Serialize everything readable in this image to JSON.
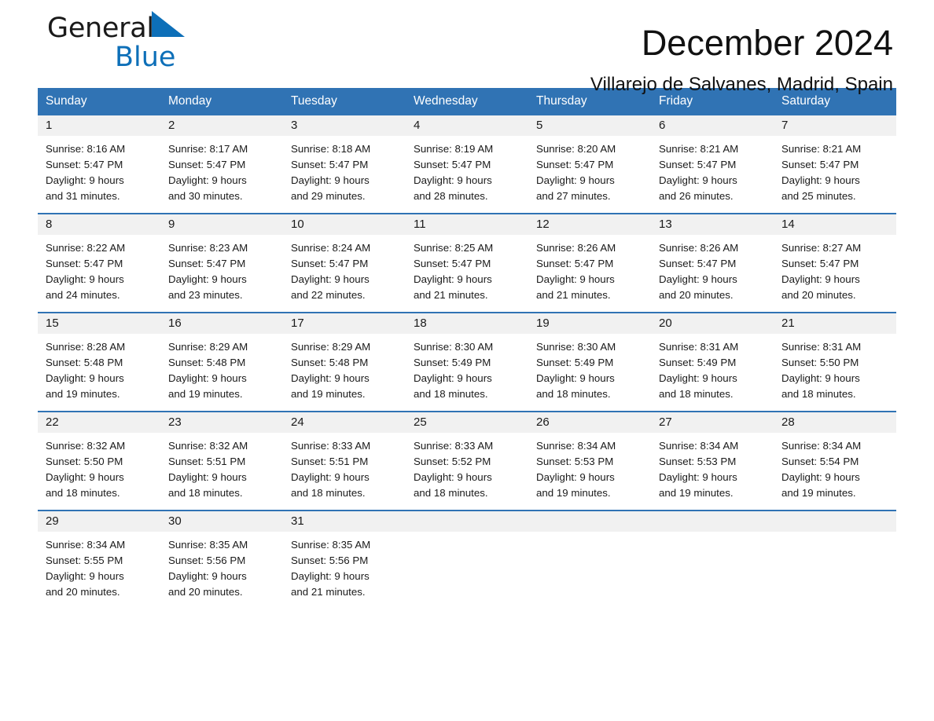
{
  "brand": {
    "logo_text_primary": "General",
    "logo_text_secondary": "Blue",
    "logo_icon": "blue-triangle-icon",
    "accent_color": "#0d6fb8"
  },
  "header": {
    "title": "December 2024",
    "location": "Villarejo de Salvanes, Madrid, Spain"
  },
  "calendar": {
    "header_background": "#3073b4",
    "daynum_background": "#f1f1f1",
    "weekday_headers": [
      "Sunday",
      "Monday",
      "Tuesday",
      "Wednesday",
      "Thursday",
      "Friday",
      "Saturday"
    ],
    "weeks": [
      [
        {
          "day": "1",
          "sunrise": "Sunrise: 8:16 AM",
          "sunset": "Sunset: 5:47 PM",
          "daylight_line1": "Daylight: 9 hours",
          "daylight_line2": "and 31 minutes."
        },
        {
          "day": "2",
          "sunrise": "Sunrise: 8:17 AM",
          "sunset": "Sunset: 5:47 PM",
          "daylight_line1": "Daylight: 9 hours",
          "daylight_line2": "and 30 minutes."
        },
        {
          "day": "3",
          "sunrise": "Sunrise: 8:18 AM",
          "sunset": "Sunset: 5:47 PM",
          "daylight_line1": "Daylight: 9 hours",
          "daylight_line2": "and 29 minutes."
        },
        {
          "day": "4",
          "sunrise": "Sunrise: 8:19 AM",
          "sunset": "Sunset: 5:47 PM",
          "daylight_line1": "Daylight: 9 hours",
          "daylight_line2": "and 28 minutes."
        },
        {
          "day": "5",
          "sunrise": "Sunrise: 8:20 AM",
          "sunset": "Sunset: 5:47 PM",
          "daylight_line1": "Daylight: 9 hours",
          "daylight_line2": "and 27 minutes."
        },
        {
          "day": "6",
          "sunrise": "Sunrise: 8:21 AM",
          "sunset": "Sunset: 5:47 PM",
          "daylight_line1": "Daylight: 9 hours",
          "daylight_line2": "and 26 minutes."
        },
        {
          "day": "7",
          "sunrise": "Sunrise: 8:21 AM",
          "sunset": "Sunset: 5:47 PM",
          "daylight_line1": "Daylight: 9 hours",
          "daylight_line2": "and 25 minutes."
        }
      ],
      [
        {
          "day": "8",
          "sunrise": "Sunrise: 8:22 AM",
          "sunset": "Sunset: 5:47 PM",
          "daylight_line1": "Daylight: 9 hours",
          "daylight_line2": "and 24 minutes."
        },
        {
          "day": "9",
          "sunrise": "Sunrise: 8:23 AM",
          "sunset": "Sunset: 5:47 PM",
          "daylight_line1": "Daylight: 9 hours",
          "daylight_line2": "and 23 minutes."
        },
        {
          "day": "10",
          "sunrise": "Sunrise: 8:24 AM",
          "sunset": "Sunset: 5:47 PM",
          "daylight_line1": "Daylight: 9 hours",
          "daylight_line2": "and 22 minutes."
        },
        {
          "day": "11",
          "sunrise": "Sunrise: 8:25 AM",
          "sunset": "Sunset: 5:47 PM",
          "daylight_line1": "Daylight: 9 hours",
          "daylight_line2": "and 21 minutes."
        },
        {
          "day": "12",
          "sunrise": "Sunrise: 8:26 AM",
          "sunset": "Sunset: 5:47 PM",
          "daylight_line1": "Daylight: 9 hours",
          "daylight_line2": "and 21 minutes."
        },
        {
          "day": "13",
          "sunrise": "Sunrise: 8:26 AM",
          "sunset": "Sunset: 5:47 PM",
          "daylight_line1": "Daylight: 9 hours",
          "daylight_line2": "and 20 minutes."
        },
        {
          "day": "14",
          "sunrise": "Sunrise: 8:27 AM",
          "sunset": "Sunset: 5:47 PM",
          "daylight_line1": "Daylight: 9 hours",
          "daylight_line2": "and 20 minutes."
        }
      ],
      [
        {
          "day": "15",
          "sunrise": "Sunrise: 8:28 AM",
          "sunset": "Sunset: 5:48 PM",
          "daylight_line1": "Daylight: 9 hours",
          "daylight_line2": "and 19 minutes."
        },
        {
          "day": "16",
          "sunrise": "Sunrise: 8:29 AM",
          "sunset": "Sunset: 5:48 PM",
          "daylight_line1": "Daylight: 9 hours",
          "daylight_line2": "and 19 minutes."
        },
        {
          "day": "17",
          "sunrise": "Sunrise: 8:29 AM",
          "sunset": "Sunset: 5:48 PM",
          "daylight_line1": "Daylight: 9 hours",
          "daylight_line2": "and 19 minutes."
        },
        {
          "day": "18",
          "sunrise": "Sunrise: 8:30 AM",
          "sunset": "Sunset: 5:49 PM",
          "daylight_line1": "Daylight: 9 hours",
          "daylight_line2": "and 18 minutes."
        },
        {
          "day": "19",
          "sunrise": "Sunrise: 8:30 AM",
          "sunset": "Sunset: 5:49 PM",
          "daylight_line1": "Daylight: 9 hours",
          "daylight_line2": "and 18 minutes."
        },
        {
          "day": "20",
          "sunrise": "Sunrise: 8:31 AM",
          "sunset": "Sunset: 5:49 PM",
          "daylight_line1": "Daylight: 9 hours",
          "daylight_line2": "and 18 minutes."
        },
        {
          "day": "21",
          "sunrise": "Sunrise: 8:31 AM",
          "sunset": "Sunset: 5:50 PM",
          "daylight_line1": "Daylight: 9 hours",
          "daylight_line2": "and 18 minutes."
        }
      ],
      [
        {
          "day": "22",
          "sunrise": "Sunrise: 8:32 AM",
          "sunset": "Sunset: 5:50 PM",
          "daylight_line1": "Daylight: 9 hours",
          "daylight_line2": "and 18 minutes."
        },
        {
          "day": "23",
          "sunrise": "Sunrise: 8:32 AM",
          "sunset": "Sunset: 5:51 PM",
          "daylight_line1": "Daylight: 9 hours",
          "daylight_line2": "and 18 minutes."
        },
        {
          "day": "24",
          "sunrise": "Sunrise: 8:33 AM",
          "sunset": "Sunset: 5:51 PM",
          "daylight_line1": "Daylight: 9 hours",
          "daylight_line2": "and 18 minutes."
        },
        {
          "day": "25",
          "sunrise": "Sunrise: 8:33 AM",
          "sunset": "Sunset: 5:52 PM",
          "daylight_line1": "Daylight: 9 hours",
          "daylight_line2": "and 18 minutes."
        },
        {
          "day": "26",
          "sunrise": "Sunrise: 8:34 AM",
          "sunset": "Sunset: 5:53 PM",
          "daylight_line1": "Daylight: 9 hours",
          "daylight_line2": "and 19 minutes."
        },
        {
          "day": "27",
          "sunrise": "Sunrise: 8:34 AM",
          "sunset": "Sunset: 5:53 PM",
          "daylight_line1": "Daylight: 9 hours",
          "daylight_line2": "and 19 minutes."
        },
        {
          "day": "28",
          "sunrise": "Sunrise: 8:34 AM",
          "sunset": "Sunset: 5:54 PM",
          "daylight_line1": "Daylight: 9 hours",
          "daylight_line2": "and 19 minutes."
        }
      ],
      [
        {
          "day": "29",
          "sunrise": "Sunrise: 8:34 AM",
          "sunset": "Sunset: 5:55 PM",
          "daylight_line1": "Daylight: 9 hours",
          "daylight_line2": "and 20 minutes."
        },
        {
          "day": "30",
          "sunrise": "Sunrise: 8:35 AM",
          "sunset": "Sunset: 5:56 PM",
          "daylight_line1": "Daylight: 9 hours",
          "daylight_line2": "and 20 minutes."
        },
        {
          "day": "31",
          "sunrise": "Sunrise: 8:35 AM",
          "sunset": "Sunset: 5:56 PM",
          "daylight_line1": "Daylight: 9 hours",
          "daylight_line2": "and 21 minutes."
        },
        {
          "day": "",
          "sunrise": "",
          "sunset": "",
          "daylight_line1": "",
          "daylight_line2": ""
        },
        {
          "day": "",
          "sunrise": "",
          "sunset": "",
          "daylight_line1": "",
          "daylight_line2": ""
        },
        {
          "day": "",
          "sunrise": "",
          "sunset": "",
          "daylight_line1": "",
          "daylight_line2": ""
        },
        {
          "day": "",
          "sunrise": "",
          "sunset": "",
          "daylight_line1": "",
          "daylight_line2": ""
        }
      ]
    ]
  }
}
